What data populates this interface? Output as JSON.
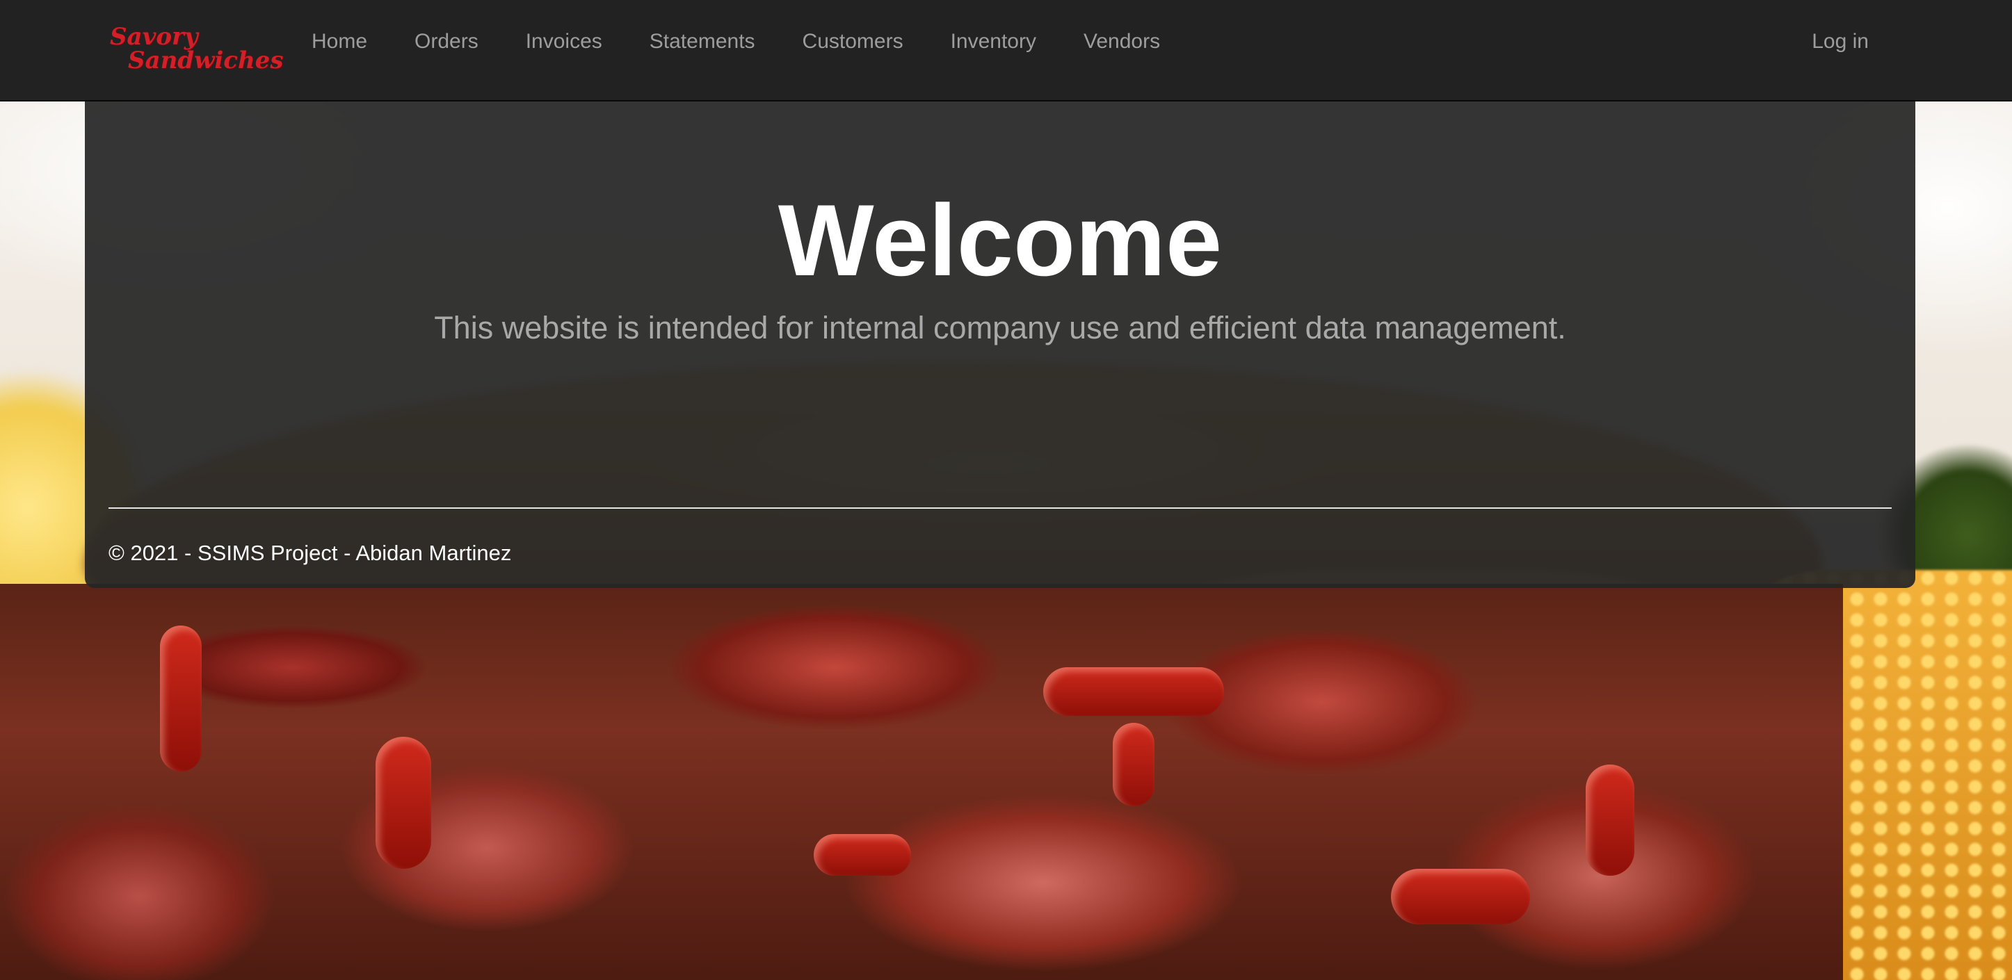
{
  "brand": {
    "line1": "Savory",
    "line2": "Sandwiches"
  },
  "nav": {
    "items": [
      {
        "label": "Home"
      },
      {
        "label": "Orders"
      },
      {
        "label": "Invoices"
      },
      {
        "label": "Statements"
      },
      {
        "label": "Customers"
      },
      {
        "label": "Inventory"
      },
      {
        "label": "Vendors"
      }
    ],
    "login_label": "Log in"
  },
  "main": {
    "title": "Welcome",
    "lead": "This website is intended for internal company use and efficient data management."
  },
  "footer": {
    "text": "© 2021 - SSIMS Project - Abidan Martinez"
  },
  "colors": {
    "navbar_bg": "#222222",
    "nav_text": "#9d9d9d",
    "brand_red": "#d32028",
    "panel_bg": "#262626"
  }
}
